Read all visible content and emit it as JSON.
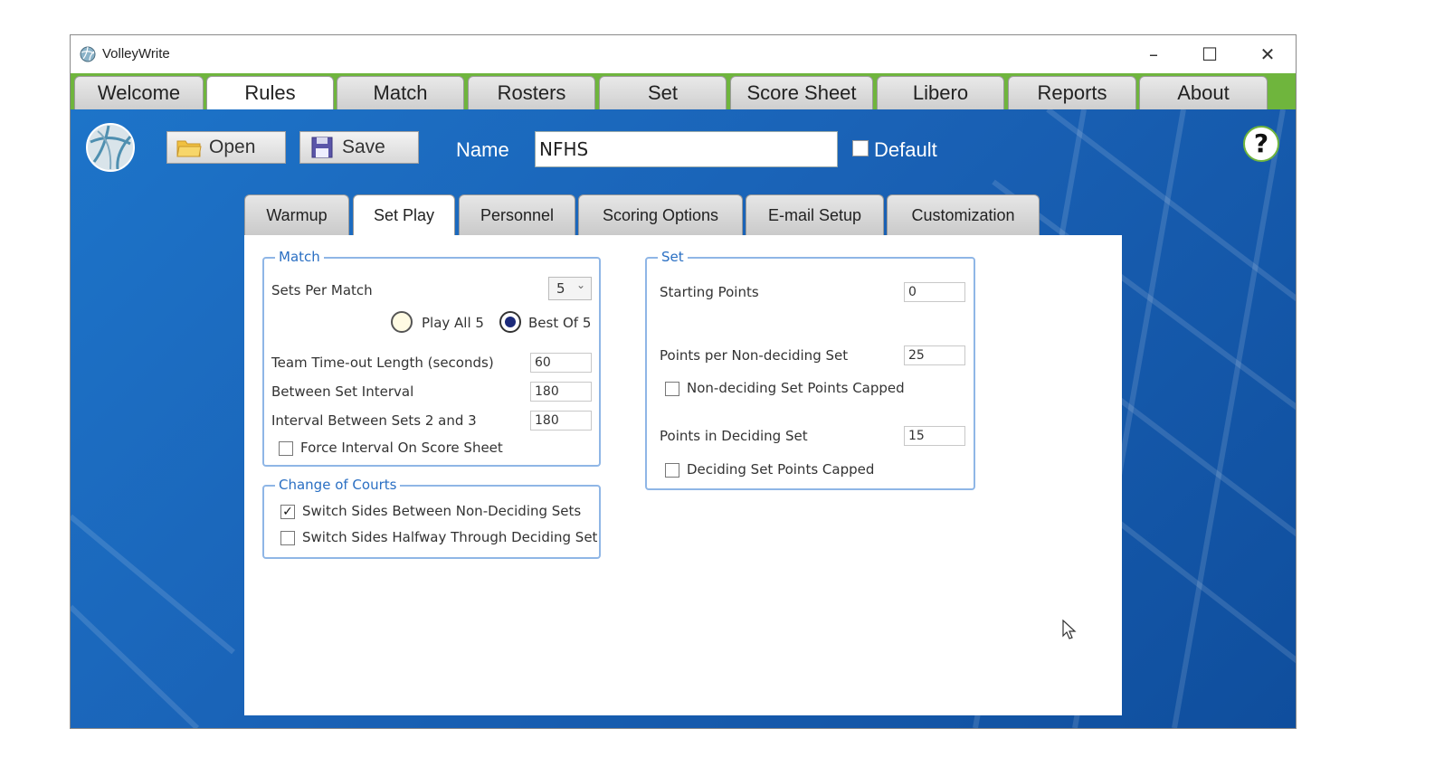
{
  "window": {
    "title": "VolleyWrite",
    "minimize_glyph": "–",
    "maximize_glyph": "☐",
    "close_glyph": "✕"
  },
  "main_tabs": [
    {
      "label": "Welcome"
    },
    {
      "label": "Rules"
    },
    {
      "label": "Match"
    },
    {
      "label": "Rosters"
    },
    {
      "label": "Set"
    },
    {
      "label": "Score Sheet"
    },
    {
      "label": "Libero"
    },
    {
      "label": "Reports"
    },
    {
      "label": "About"
    }
  ],
  "active_main_tab": "Rules",
  "toolbar": {
    "open_label": "Open",
    "save_label": "Save",
    "name_label": "Name",
    "name_value": "NFHS",
    "default_label": "Default",
    "default_checked": false,
    "help_glyph": "?"
  },
  "sub_tabs": [
    {
      "label": "Warmup"
    },
    {
      "label": "Set Play"
    },
    {
      "label": "Personnel"
    },
    {
      "label": "Scoring Options"
    },
    {
      "label": "E-mail Setup"
    },
    {
      "label": "Customization"
    }
  ],
  "active_sub_tab": "Set Play",
  "match_group": {
    "legend": "Match",
    "sets_per_match_label": "Sets Per Match",
    "sets_per_match_value": "5",
    "play_all_label": "Play All 5",
    "best_of_label": "Best Of 5",
    "selected_mode": "Best Of 5",
    "timeout_label": "Team Time-out Length (seconds)",
    "timeout_value": "60",
    "between_set_label": "Between Set Interval",
    "between_set_value": "180",
    "interval_23_label": "Interval Between Sets 2 and 3",
    "interval_23_value": "180",
    "force_interval_label": "Force Interval On Score Sheet",
    "force_interval_checked": false
  },
  "courts_group": {
    "legend": "Change of Courts",
    "switch_non_deciding_label": "Switch Sides Between Non-Deciding Sets",
    "switch_non_deciding_checked": true,
    "switch_halfway_label": "Switch Sides Halfway Through Deciding Set",
    "switch_halfway_checked": false
  },
  "set_group": {
    "legend": "Set",
    "starting_points_label": "Starting Points",
    "starting_points_value": "0",
    "non_deciding_points_label": "Points per Non-deciding Set",
    "non_deciding_points_value": "25",
    "non_deciding_capped_label": "Non-deciding Set Points Capped",
    "non_deciding_capped_checked": false,
    "deciding_points_label": "Points in Deciding Set",
    "deciding_points_value": "15",
    "deciding_capped_label": "Deciding Set Points Capped",
    "deciding_capped_checked": false
  },
  "colors": {
    "tabbar_green": "#6fb53d",
    "background_blue": "#1a62b6",
    "group_border": "#8fb6e6",
    "legend_text": "#2a6fc3"
  },
  "icons": {
    "app": "volleyball-icon",
    "open": "folder-icon",
    "save": "floppy-disk-icon",
    "help": "help-icon"
  }
}
